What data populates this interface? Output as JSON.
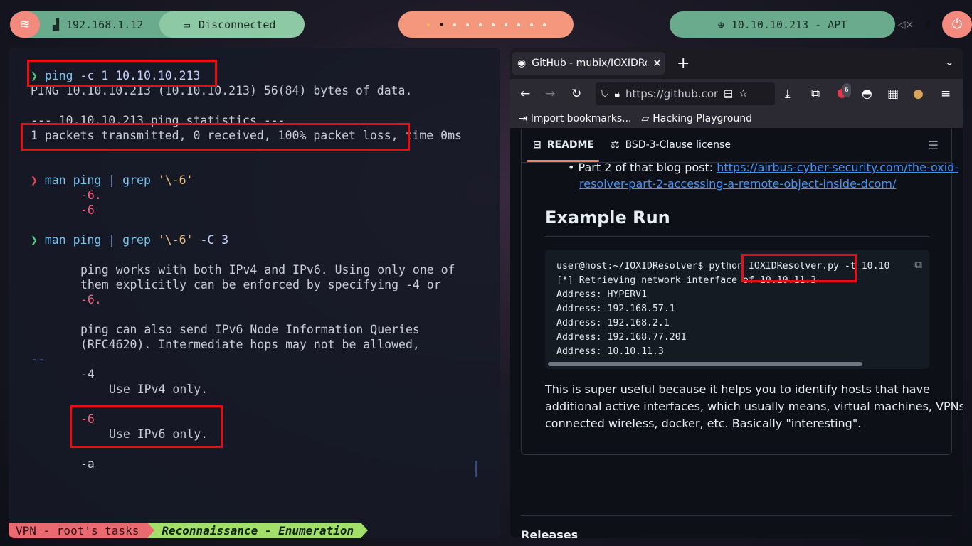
{
  "topbar": {
    "ip_address": "192.168.1.12",
    "vpn_status": "Disconnected",
    "workspaces": [
      "1",
      "2",
      "3",
      "4",
      "5",
      "6",
      "7",
      "8",
      "9",
      "10"
    ],
    "target": "10.10.10.213 - APT",
    "colors": {
      "green": "#6aab8e",
      "light_green": "#8ec9a5",
      "salmon": "#f4977c",
      "red_accent": "#f4897e"
    }
  },
  "terminal": {
    "lines": [
      {
        "prompt": "❯",
        "cmd": "ping",
        "args": " -c 1 10.10.10.213"
      },
      {
        "text": "PING 10.10.10.213 (10.10.10.213) 56(84) bytes of data."
      },
      {
        "text": "--- 10.10.10.213 ping statistics ---"
      },
      {
        "text": "1 packets transmitted, 0 received, 100% packet loss, time 0ms"
      },
      {
        "prompt": "❯",
        "cmd": "man ping",
        "pipe": " | ",
        "cmd2": "grep",
        "str": " '\\-6'"
      },
      {
        "text": "-6."
      },
      {
        "text": "-6"
      },
      {
        "prompt": "❯",
        "cmd": "man ping",
        "pipe": " | ",
        "cmd2": "grep",
        "str": " '\\-6'",
        "args": " -C 3"
      },
      {
        "text": "ping works with both IPv4 and IPv6. Using only one of"
      },
      {
        "text": "them explicitly can be enforced by specifying -4 or"
      },
      {
        "text": "-6."
      },
      {
        "text": "ping can also send IPv6 Node Information Queries"
      },
      {
        "text": "(RFC4620). Intermediate hops may not be allowed,"
      },
      {
        "text": "--"
      },
      {
        "text": "-4"
      },
      {
        "text": "Use IPv4 only."
      },
      {
        "text": "-6"
      },
      {
        "text": "Use IPv6 only."
      },
      {
        "text": "-a"
      }
    ],
    "status": {
      "session": "VPN - root's tasks",
      "task": "Reconnaissance - Enumeration"
    }
  },
  "browser": {
    "tab_title": "GitHub - mubix/IOXIDResolver",
    "url": "https://github.com/mubix/IOXIDResolver",
    "notification_badge": "6",
    "bookmarks": [
      "Import bookmarks...",
      "Hacking Playground"
    ],
    "readme_tabs": [
      "README",
      "BSD-3-Clause license"
    ],
    "bullet_prefix": "Part 2 of that blog post: ",
    "bullet_link_1": "https://airbus-cyber-security.com/the-oxid-",
    "bullet_link_2": "resolver-part-2-accessing-a-remote-object-inside-dcom/",
    "heading": "Example Run",
    "code": [
      "user@host:~/IOXIDResolver$ python IOXIDResolver.py -t 10.10",
      "[*] Retrieving network interface of 10.10.11.3",
      "Address: HYPERV1",
      "Address: 192.168.57.1",
      "Address: 192.168.2.1",
      "Address: 192.168.77.201",
      "Address: 10.10.11.3"
    ],
    "paragraph": [
      "This is super useful because it helps you to identify hosts that have",
      "additional active interfaces, which usually means, virtual machines, VPNs,",
      "connected wireless, docker, etc. Basically \"interesting\"."
    ],
    "releases": "Releases"
  }
}
